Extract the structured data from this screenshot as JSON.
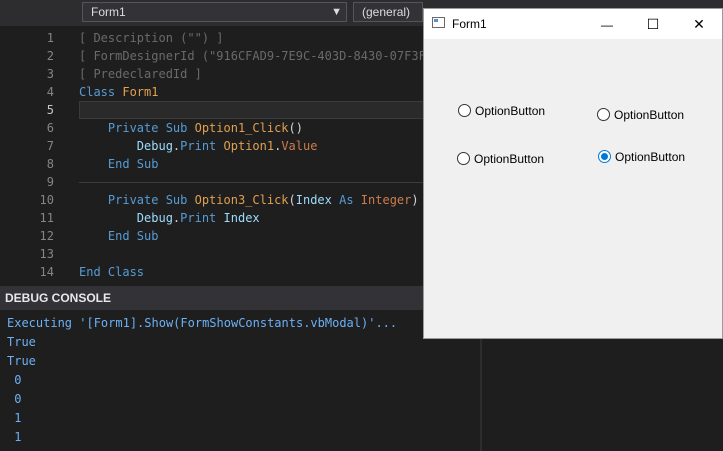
{
  "toolbar": {
    "object_combo": "Form1",
    "proc_combo": "(general)"
  },
  "editor": {
    "line_numbers": [
      "1",
      "2",
      "3",
      "4",
      "5",
      "6",
      "7",
      "8",
      "9",
      "10",
      "11",
      "12",
      "13",
      "14"
    ],
    "lines": [
      {
        "tokens": [
          {
            "t": "[ Description (\"\") ]",
            "c": "c-cm"
          }
        ]
      },
      {
        "tokens": [
          {
            "t": "[ FormDesignerId (\"916CFAD9-7E9C-403D-8430-07F3F",
            "c": "c-cm"
          }
        ]
      },
      {
        "tokens": [
          {
            "t": "[ PredeclaredId ]",
            "c": "c-cm"
          }
        ]
      },
      {
        "tokens": [
          {
            "t": "Class ",
            "c": "c-kw"
          },
          {
            "t": "Form1",
            "c": "c-nm"
          }
        ]
      },
      {
        "tokens": []
      },
      {
        "tokens": [
          {
            "t": "    Private Sub ",
            "c": "c-kw"
          },
          {
            "t": "Option1_Click",
            "c": "c-nm"
          },
          {
            "t": "()",
            "c": "c-pl"
          }
        ]
      },
      {
        "tokens": [
          {
            "t": "        Debug",
            "c": "c-id"
          },
          {
            "t": ".",
            "c": "c-pl"
          },
          {
            "t": "Print ",
            "c": "c-kw"
          },
          {
            "t": "Option1",
            "c": "c-nm"
          },
          {
            "t": ".",
            "c": "c-pl"
          },
          {
            "t": "Value",
            "c": "c-pr"
          }
        ]
      },
      {
        "tokens": [
          {
            "t": "    End Sub",
            "c": "c-kw"
          }
        ]
      },
      {
        "tokens": []
      },
      {
        "tokens": [
          {
            "t": "    Private Sub ",
            "c": "c-kw"
          },
          {
            "t": "Option3_Click",
            "c": "c-nm"
          },
          {
            "t": "(",
            "c": "c-pl"
          },
          {
            "t": "Index ",
            "c": "c-id"
          },
          {
            "t": "As ",
            "c": "c-kw"
          },
          {
            "t": "Integer",
            "c": "c-pr"
          },
          {
            "t": ")",
            "c": "c-pl"
          }
        ]
      },
      {
        "tokens": [
          {
            "t": "        Debug",
            "c": "c-id"
          },
          {
            "t": ".",
            "c": "c-pl"
          },
          {
            "t": "Print ",
            "c": "c-kw"
          },
          {
            "t": "Index",
            "c": "c-id"
          }
        ]
      },
      {
        "tokens": [
          {
            "t": "    End Sub",
            "c": "c-kw"
          }
        ]
      },
      {
        "tokens": []
      },
      {
        "tokens": [
          {
            "t": "End Class",
            "c": "c-kw"
          }
        ]
      }
    ]
  },
  "debug_console": {
    "title": "DEBUG CONSOLE",
    "lines": [
      "Executing '[Form1].Show(FormShowConstants.vbModal)'...",
      "True",
      "True",
      " 0",
      " 0",
      " 1",
      " 1"
    ]
  },
  "form": {
    "title": "Form1",
    "minimize_glyph": "—",
    "maximize_glyph": "☐",
    "close_glyph": "✕",
    "options": [
      {
        "label": "OptionButton",
        "checked": false
      },
      {
        "label": "OptionButton",
        "checked": false
      },
      {
        "label": "OptionButton",
        "checked": false
      },
      {
        "label": "OptionButton",
        "checked": true
      }
    ]
  },
  "colors": {
    "editor_bg": "#1e1e1e",
    "accent": "#0078d7",
    "console_text": "#6cb0f5"
  }
}
